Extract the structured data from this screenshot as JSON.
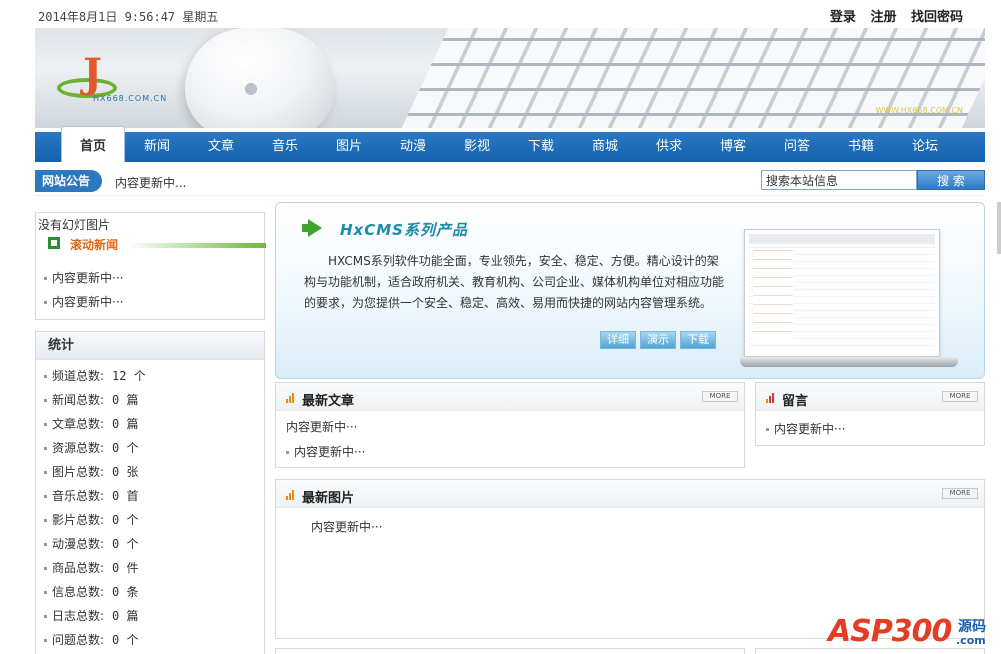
{
  "header": {
    "date": "2014年8月1日 9:56:47 星期五",
    "links": [
      "登录",
      "注册",
      "找回密码"
    ]
  },
  "banner": {
    "logo_text": "HX668.COM.CN",
    "url_text": "WWW.HX668.COM.CN"
  },
  "nav": {
    "items": [
      "首页",
      "新闻",
      "文章",
      "音乐",
      "图片",
      "动漫",
      "影视",
      "下载",
      "商城",
      "供求",
      "博客",
      "问答",
      "书籍",
      "论坛"
    ],
    "active": "首页"
  },
  "notice": {
    "label": "网站公告",
    "text": "内容更新中..."
  },
  "search": {
    "value": "搜索本站信息",
    "button": "搜 索"
  },
  "slide": {
    "empty_text": "没有幻灯图片",
    "title": "滚动新闻",
    "items": [
      "内容更新中···",
      "内容更新中···"
    ]
  },
  "stats": {
    "title": "统计",
    "items": [
      {
        "label": "频道总数:",
        "value": "12 个"
      },
      {
        "label": "新闻总数:",
        "value": "0 篇"
      },
      {
        "label": "文章总数:",
        "value": "0 篇"
      },
      {
        "label": "资源总数:",
        "value": "0 个"
      },
      {
        "label": "图片总数:",
        "value": "0 张"
      },
      {
        "label": "音乐总数:",
        "value": "0 首"
      },
      {
        "label": "影片总数:",
        "value": "0 个"
      },
      {
        "label": "动漫总数:",
        "value": "0 个"
      },
      {
        "label": "商品总数:",
        "value": "0 件"
      },
      {
        "label": "信息总数:",
        "value": "0 条"
      },
      {
        "label": "日志总数:",
        "value": "0 篇"
      },
      {
        "label": "问题总数:",
        "value": "0 个"
      }
    ]
  },
  "promo": {
    "title": "HxCMS系列产品",
    "description": "HXCMS系列软件功能全面，专业领先，安全、稳定、方便。精心设计的架构与功能机制，适合政府机关、教育机构、公司企业、媒体机构单位对相应功能的要求，为您提供一个安全、稳定、高效、易用而快捷的网站内容管理系统。",
    "buttons": [
      "详细",
      "演示",
      "下载"
    ]
  },
  "panels": {
    "articles": {
      "title": "最新文章",
      "more": "MORE",
      "plain": "内容更新中···",
      "items": [
        "内容更新中···"
      ]
    },
    "messages": {
      "title": "留言",
      "more": "MORE",
      "items": [
        "内容更新中···"
      ]
    },
    "pictures": {
      "title": "最新图片",
      "more": "MORE",
      "plain": "内容更新中···"
    }
  },
  "watermark": {
    "brand": "ASP300",
    "suffix": "源码",
    "domain": ".com"
  }
}
